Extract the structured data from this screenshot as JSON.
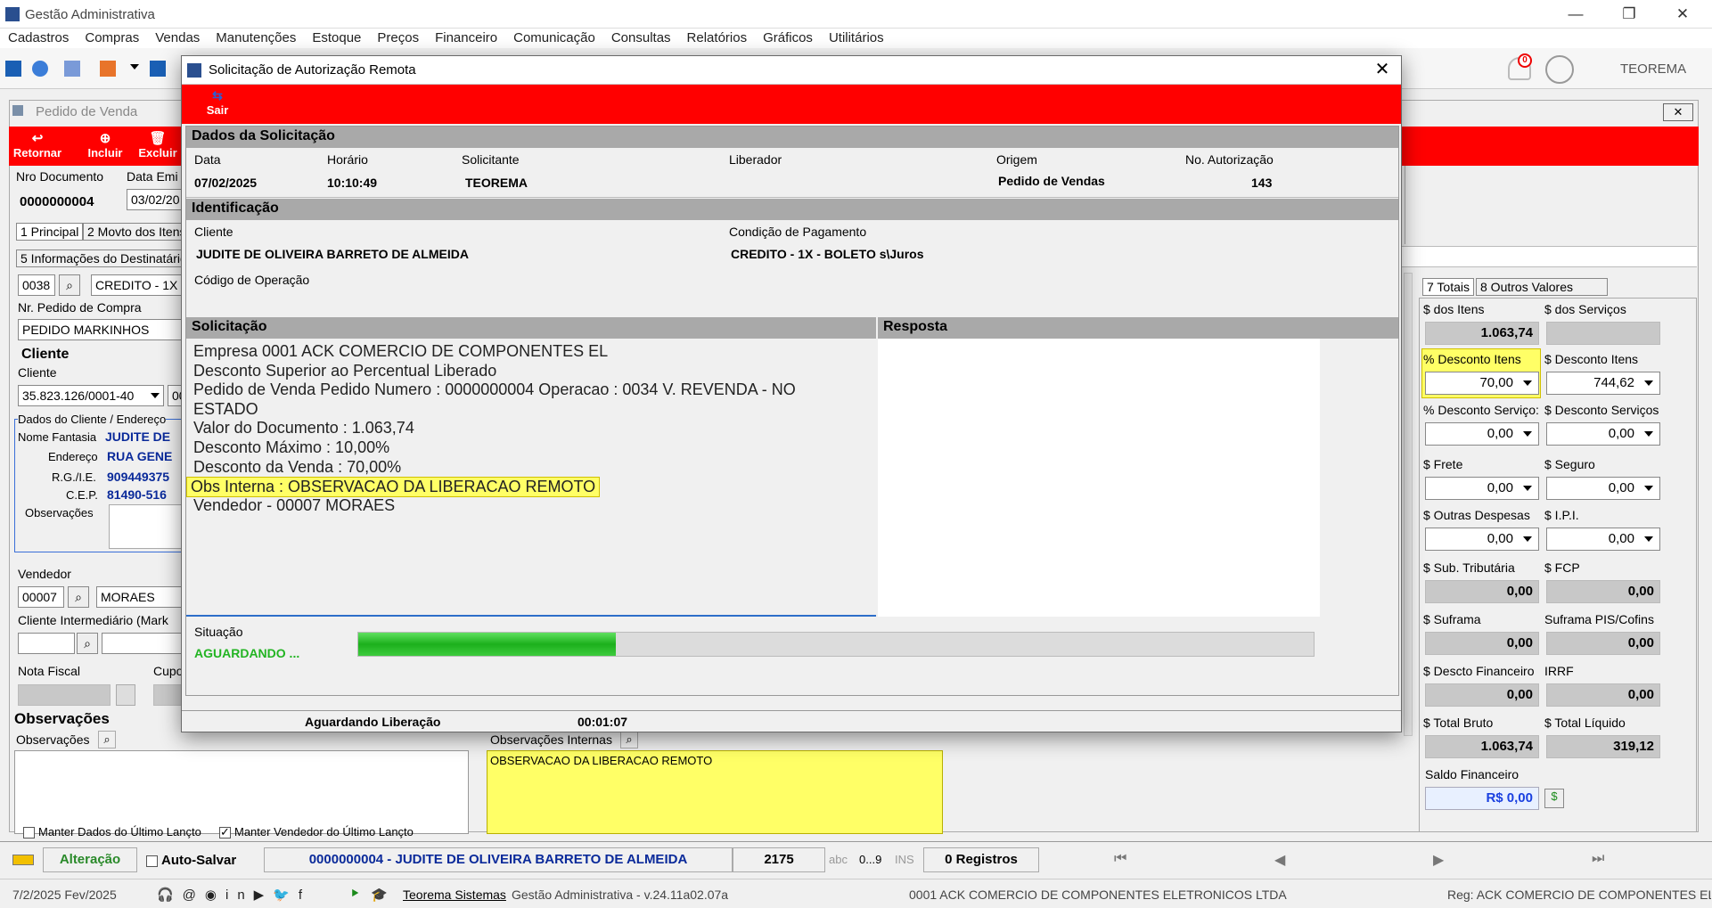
{
  "app": {
    "title": "Gestão Administrativa",
    "user": "TEOREMA",
    "notif_count": "0"
  },
  "menu": [
    "Cadastros",
    "Compras",
    "Vendas",
    "Manutenções",
    "Estoque",
    "Preços",
    "Financeiro",
    "Comunicação",
    "Consultas",
    "Relatórios",
    "Gráficos",
    "Utilitários"
  ],
  "form": {
    "title": "Pedido de Venda",
    "buttons": {
      "retornar": "Retornar",
      "incluir": "Incluir",
      "excluir": "Excluir"
    },
    "nro_doc_label": "Nro Documento",
    "nro_doc": "0000000004",
    "data_label": "Data Emi",
    "data_value": "03/02/20",
    "tabs": [
      "1 Principal",
      "2 Movto dos Itens"
    ],
    "tab5": "5 Informações do Destinatário",
    "cond_code": "0038",
    "cond_text": "CREDITO - 1X -",
    "nr_pedido_label": "Nr. Pedido de Compra",
    "nr_pedido": "PEDIDO MARKINHOS",
    "cliente_hdr": "Cliente",
    "cliente_label": "Cliente",
    "cliente_cnpj": "35.823.126/0001-40",
    "cliente_extra": "00",
    "dados_label": "Dados do Cliente / Endereço",
    "nome_fantasia_label": "Nome Fantasia",
    "nome_fantasia": "JUDITE DE",
    "endereco_label": "Endereço",
    "endereco": "RUA GENE",
    "rg_label": "R.G./I.E.",
    "rg": "909449375",
    "cep_label": "C.E.P.",
    "cep": "81490-516",
    "obs_label": "Observações",
    "vendedor_label": "Vendedor",
    "vendedor_code": "00007",
    "vendedor_name": "MORAES",
    "cli_inter_label": "Cliente Intermediário (Mark",
    "nota_label": "Nota Fiscal",
    "cupom_label": "Cupo",
    "observacoes_hdr": "Observações",
    "observacoes_label": "Observações",
    "obs_internas_label": "Observações Internas",
    "obs_internas": "OBSERVACAO DA LIBERACAO REMOTO",
    "manter_dados": "Manter Dados do Último Lançto",
    "manter_vendedor": "Manter Vendedor do Último Lançto"
  },
  "totals": {
    "tabs": [
      "7 Totais",
      "8 Outros Valores"
    ],
    "dos_itens_label": "$ dos Itens",
    "dos_itens": "1.063,74",
    "dos_servicos_label": "$ dos Serviços",
    "pct_desc_itens_label": "% Desconto Itens",
    "pct_desc_itens": "70,00",
    "desc_itens_label": "$ Desconto Itens",
    "desc_itens": "744,62",
    "pct_desc_serv_label": "% Desconto Serviço:",
    "pct_desc_serv": "0,00",
    "desc_serv_label": "$ Desconto Serviços",
    "desc_serv": "0,00",
    "frete_label": "$ Frete",
    "frete": "0,00",
    "seguro_label": "$ Seguro",
    "seguro": "0,00",
    "outras_label": "$ Outras Despesas",
    "outras": "0,00",
    "ipi_label": "$ I.P.I.",
    "ipi": "0,00",
    "subtrib_label": "$ Sub. Tributária",
    "subtrib": "0,00",
    "fcp_label": "$ FCP",
    "fcp": "0,00",
    "suframa_label": "$ Suframa",
    "suframa": "0,00",
    "suframa_pis_label": "Suframa PIS/Cofins",
    "suframa_pis": "0,00",
    "desc_fin_label": "$ Descto Financeiro",
    "desc_fin": "0,00",
    "irrf_label": "IRRF",
    "irrf": "0,00",
    "bruto_label": "$ Total Bruto",
    "bruto": "1.063,74",
    "liquido_label": "$ Total Líquido",
    "liquido": "319,12",
    "saldo_label": "Saldo Financeiro",
    "saldo": "R$ 0,00"
  },
  "modal": {
    "title": "Solicitação de Autorização Remota",
    "sair": "Sair",
    "dados_hdr": "Dados da Solicitação",
    "data_label": "Data",
    "data": "07/02/2025",
    "horario_label": "Horário",
    "horario": "10:10:49",
    "solicitante_label": "Solicitante",
    "solicitante": "TEOREMA",
    "liberador_label": "Liberador",
    "origem_label": "Origem",
    "origem": "Pedido de Vendas",
    "autorizacao_label": "No. Autorização",
    "autorizacao": "143",
    "ident_hdr": "Identificação",
    "cliente_label": "Cliente",
    "cliente": "JUDITE DE OLIVEIRA BARRETO DE ALMEIDA",
    "cond_label": "Condição de Pagamento",
    "cond": "CREDITO - 1X - BOLETO s\\Juros",
    "codop_label": "Código de Operação",
    "solic_hdr": "Solicitação",
    "resp_hdr": "Resposta",
    "lines": [
      "Empresa 0001 ACK COMERCIO DE COMPONENTES EL",
      "Desconto Superior ao Percentual Liberado",
      "Pedido de Venda Pedido Numero : 0000000004 Operacao : 0034 V. REVENDA - NO",
      "ESTADO",
      "Valor do Documento : 1.063,74",
      "Desconto Máximo : 10,00%",
      "Desconto da Venda : 70,00%",
      "Obs Interna  : OBSERVACAO DA LIBERACAO REMOTO",
      "Vendedor - 00007 MORAES"
    ],
    "situacao_label": "Situação",
    "situacao": "AGUARDANDO ...",
    "progress": 0.27,
    "status": "Aguardando Liberação",
    "timer": "00:01:07"
  },
  "statusbar": {
    "mode": "Alteração",
    "autosave": "Auto-Salvar",
    "doc": "0000000004 - JUDITE DE OLIVEIRA BARRETO DE ALMEIDA",
    "num": "2175",
    "abc": "abc",
    "nums": "0...9",
    "ins": "INS",
    "registros": "0 Registros"
  },
  "bottom": {
    "date": "7/2/2025 Fev/2025",
    "link": "Teorema Sistemas",
    "version": "Gestão Administrativa - v.24.11a02.07a",
    "company": "0001 ACK COMERCIO DE COMPONENTES ELETRONICOS LTDA",
    "reg": "Reg: ACK COMERCIO DE COMPONENTES EL"
  },
  "colors": {
    "red": "#ff0000",
    "yellow": "#ffff66",
    "green": "#22c422",
    "navy": "#0a2a9a"
  }
}
